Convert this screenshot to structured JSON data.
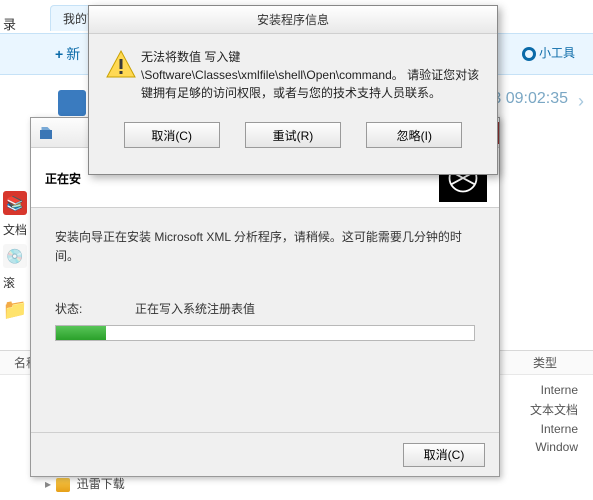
{
  "background": {
    "tab_label": "我的下",
    "left_edge_label": "录",
    "new_label": "新",
    "tool_label": "小工具",
    "timestamp_partial": "3 09:02:35",
    "leftbar_text_label": "文档",
    "leftbar_scroll_label": "滚",
    "list": {
      "col_name": "名称",
      "col_type": "类型",
      "rows": [
        "Interne",
        "文本文档",
        "Interne",
        "Window"
      ]
    },
    "tree_label": "迅雷下载"
  },
  "wizard": {
    "banner_title": "正在安",
    "message": "安装向导正在安装 Microsoft XML 分析程序，请稍候。这可能需要几分钟的时间。",
    "status_label": "状态:",
    "status_text": "正在写入系统注册表值",
    "progress_pct": 12,
    "cancel_label": "取消(C)"
  },
  "dialog": {
    "title": "安装程序信息",
    "line1": "无法将数值   写入键",
    "line2": "\\Software\\Classes\\xmlfile\\shell\\Open\\command。 请验证您对该键拥有足够的访问权限，或者与您的技术支持人员联系。",
    "btn_cancel": "取消(C)",
    "btn_retry": "重试(R)",
    "btn_ignore": "忽略(I)"
  }
}
